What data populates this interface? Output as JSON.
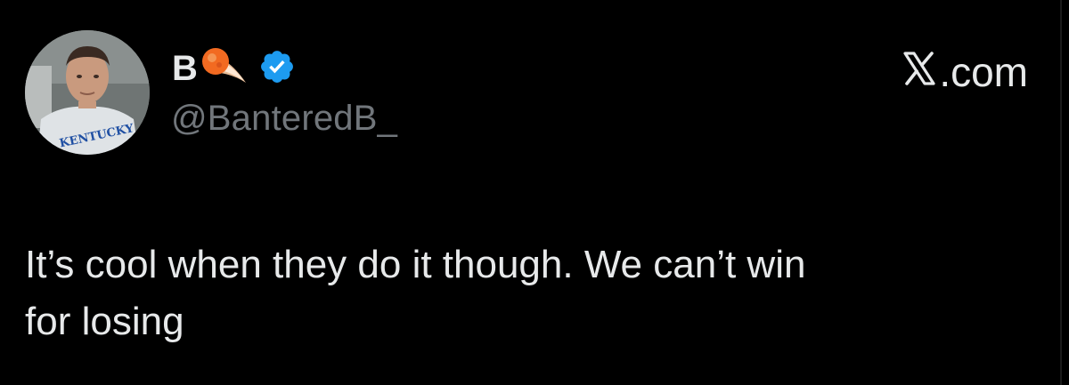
{
  "tweet": {
    "author": {
      "display_name": "B",
      "name_emoji": "comet-icon",
      "verified_badge": "verified-icon",
      "handle": "@BanteredB_",
      "avatar_text": "KENTUCKY"
    },
    "source": {
      "logo": "x-logo-icon",
      "label": ".com"
    },
    "text_lines": [
      "It’s cool when they do it though. We can’t win",
      "for losing"
    ]
  },
  "colors": {
    "background": "#000000",
    "primary_text": "#e7e9ea",
    "secondary_text": "#71767b",
    "verified_blue": "#1d9bf0"
  }
}
